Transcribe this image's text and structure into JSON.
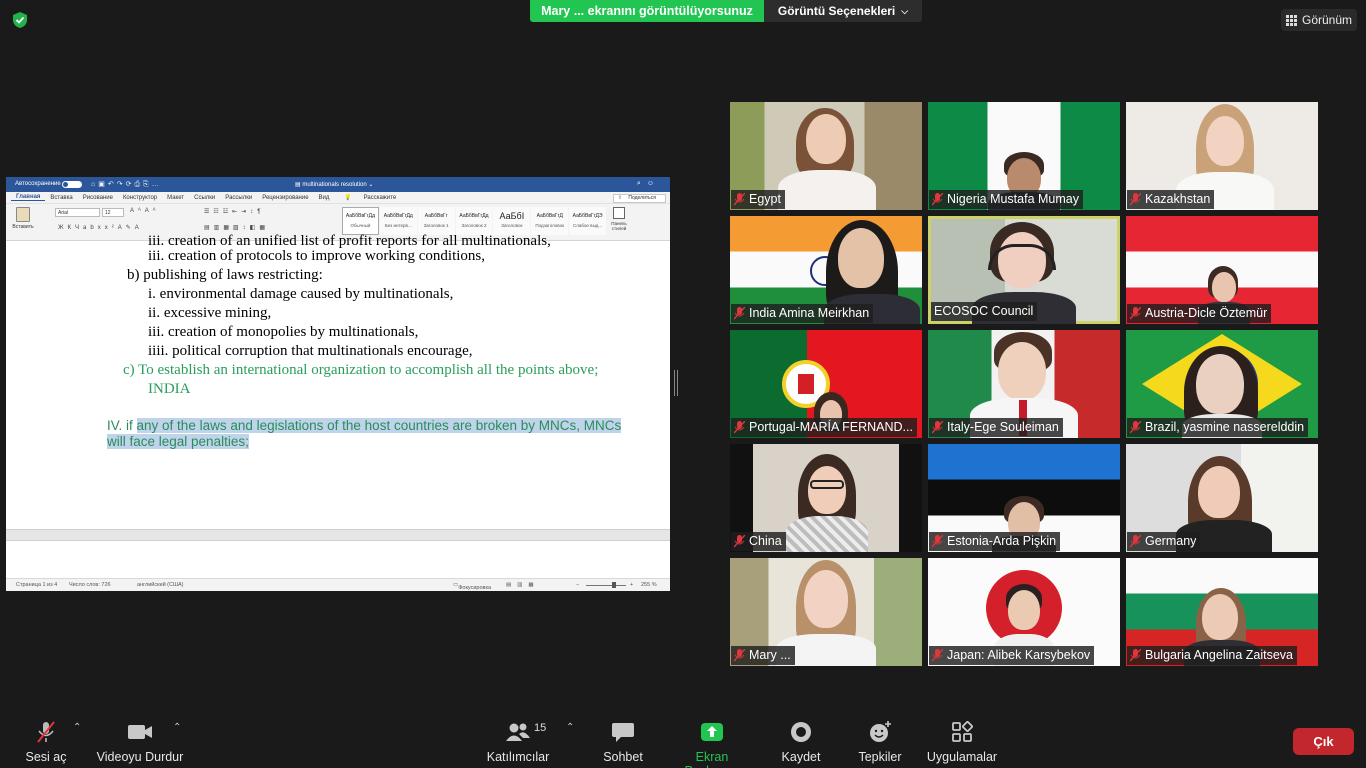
{
  "top": {
    "share_banner": "Mary ... ekranını görüntülüyorsunuz",
    "view_options": "Görüntü Seçenekleri",
    "view_button": "Görünüm"
  },
  "word": {
    "autosave": "Автосохранение",
    "doc_name": "multinationals resolution",
    "tabs": [
      "Главная",
      "Вставка",
      "Рисование",
      "Конструктор",
      "Макет",
      "Ссылки",
      "Рассылки",
      "Рецензирование",
      "Вид",
      "Расскажите"
    ],
    "share": "Поделиться",
    "paste": "Вставить",
    "font": "Arial",
    "font_size": "12",
    "styles": [
      "Обычный",
      "Без интерв...",
      "Заголовок 1",
      "Заголовок 2",
      "Заголовок",
      "Подзаголовок",
      "Слабое выд..."
    ],
    "styles_preview": [
      "АаБбВвГгДд",
      "АаБбВвГгДд",
      "АаБбВвГг",
      "АаБбВвГгДд",
      "АаБбI",
      "АаБбВвГгД",
      "АаБбВвГгДЭ"
    ],
    "styles_pane": "Панель стилей",
    "lines": {
      "l0": "iii. creation of an unified list of profit reports for all multinationals,",
      "l1": "iii. creation of protocols to improve working conditions,",
      "l2": "b) publishing of laws restricting:",
      "l3": "i. environmental damage caused by multinationals,",
      "l4": "ii. excessive mining,",
      "l5": "iii. creation of monopolies by multinationals,",
      "l6": "iiii. political corruption that multinationals encourage,",
      "l7": "c) To establish an international organization to accomplish all the points above;",
      "l8": "INDIA",
      "l9a": "IV. if ",
      "l9b": "any of the laws and legislations of the host countries are broken by MNCs, MNCs",
      "l10": "will face legal penalties;"
    },
    "status": {
      "page": "Страница 1 из 4",
      "words": "Число слов: 726",
      "lang": "английский (США)",
      "focus": "Фокусировка",
      "zoom": "255 %"
    }
  },
  "participants": [
    {
      "name": "Egypt"
    },
    {
      "name": "Nigeria Mustafa Mumay"
    },
    {
      "name": "Kazakhstan"
    },
    {
      "name": "India Amina Meirkhan"
    },
    {
      "name": "ECOSOC Council"
    },
    {
      "name": "Austria-Dicle Öztemür"
    },
    {
      "name": "Portugal-MARÍA FERNAND..."
    },
    {
      "name": "Italy-Ege Souleiman"
    },
    {
      "name": "Brazil, yasmine nasserelddin"
    },
    {
      "name": "China"
    },
    {
      "name": "Estonia-Arda Pişkin"
    },
    {
      "name": "Germany"
    },
    {
      "name": "Mary ..."
    },
    {
      "name": "Japan: Alibek Karsybekov"
    },
    {
      "name": "Bulgaria Angelina Zaitseva"
    }
  ],
  "toolbar": {
    "mute": "Sesi aç",
    "video": "Videoyu Durdur",
    "participants": "Katılımcılar",
    "participants_count": "15",
    "chat": "Sohbet",
    "share": "Ekran Paylaşımı",
    "record": "Kaydet",
    "reactions": "Tepkiler",
    "apps": "Uygulamalar",
    "leave": "Çık"
  },
  "colors": {
    "share_green": "#23c552",
    "leave_red": "#c1272d",
    "active_speaker": "#ccd26a",
    "word_blue": "#2b579a"
  }
}
